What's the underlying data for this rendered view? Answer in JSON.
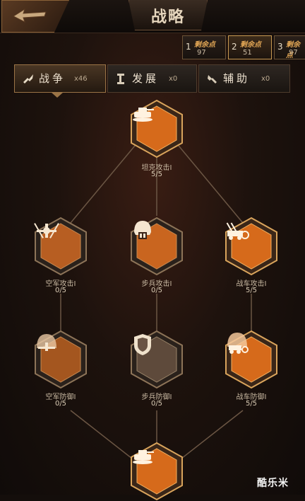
{
  "header": {
    "title": "战略"
  },
  "skill_points": [
    {
      "index": "1",
      "label": "剩余点",
      "value": "97",
      "active": false
    },
    {
      "index": "2",
      "label": "剩余点",
      "value": "51",
      "active": true
    },
    {
      "index": "3",
      "label": "剩余点",
      "value": "97",
      "active": false
    }
  ],
  "tabs": [
    {
      "label": "战争",
      "count": "x46",
      "icon": "war-icon",
      "active": true
    },
    {
      "label": "发展",
      "count": "x0",
      "icon": "development-icon",
      "active": false
    },
    {
      "label": "辅助",
      "count": "x0",
      "icon": "support-icon",
      "active": false
    }
  ],
  "nodes": [
    {
      "id": "tank-attack",
      "name": "坦克攻击I",
      "progress": "5/5",
      "icon": "tank-icon",
      "lit": true
    },
    {
      "id": "air-attack",
      "name": "空军攻击I",
      "progress": "0/5",
      "icon": "aircraft-icon",
      "lit": false
    },
    {
      "id": "infantry-attack",
      "name": "步兵攻击I",
      "progress": "0/5",
      "icon": "helmet-icon",
      "lit": false
    },
    {
      "id": "vehicle-attack",
      "name": "战车攻击I",
      "progress": "5/5",
      "icon": "artillery-vehicle-icon",
      "lit": true
    },
    {
      "id": "air-defense",
      "name": "空军防御I",
      "progress": "0/5",
      "icon": "aircraft-dome-icon",
      "lit": false
    },
    {
      "id": "infantry-defense",
      "name": "步兵防御I",
      "progress": "0/5",
      "icon": "shield-icon",
      "lit": false
    },
    {
      "id": "vehicle-defense",
      "name": "战车防御I",
      "progress": "5/5",
      "icon": "vehicle-dome-icon",
      "lit": true
    },
    {
      "id": "tank-bottom",
      "name": "",
      "progress": "",
      "icon": "tank-icon",
      "lit": true
    }
  ],
  "watermark": "酷乐米",
  "colors": {
    "lit": "#e0701e",
    "unlit": "#5a4636",
    "accent": "#c89a52"
  }
}
